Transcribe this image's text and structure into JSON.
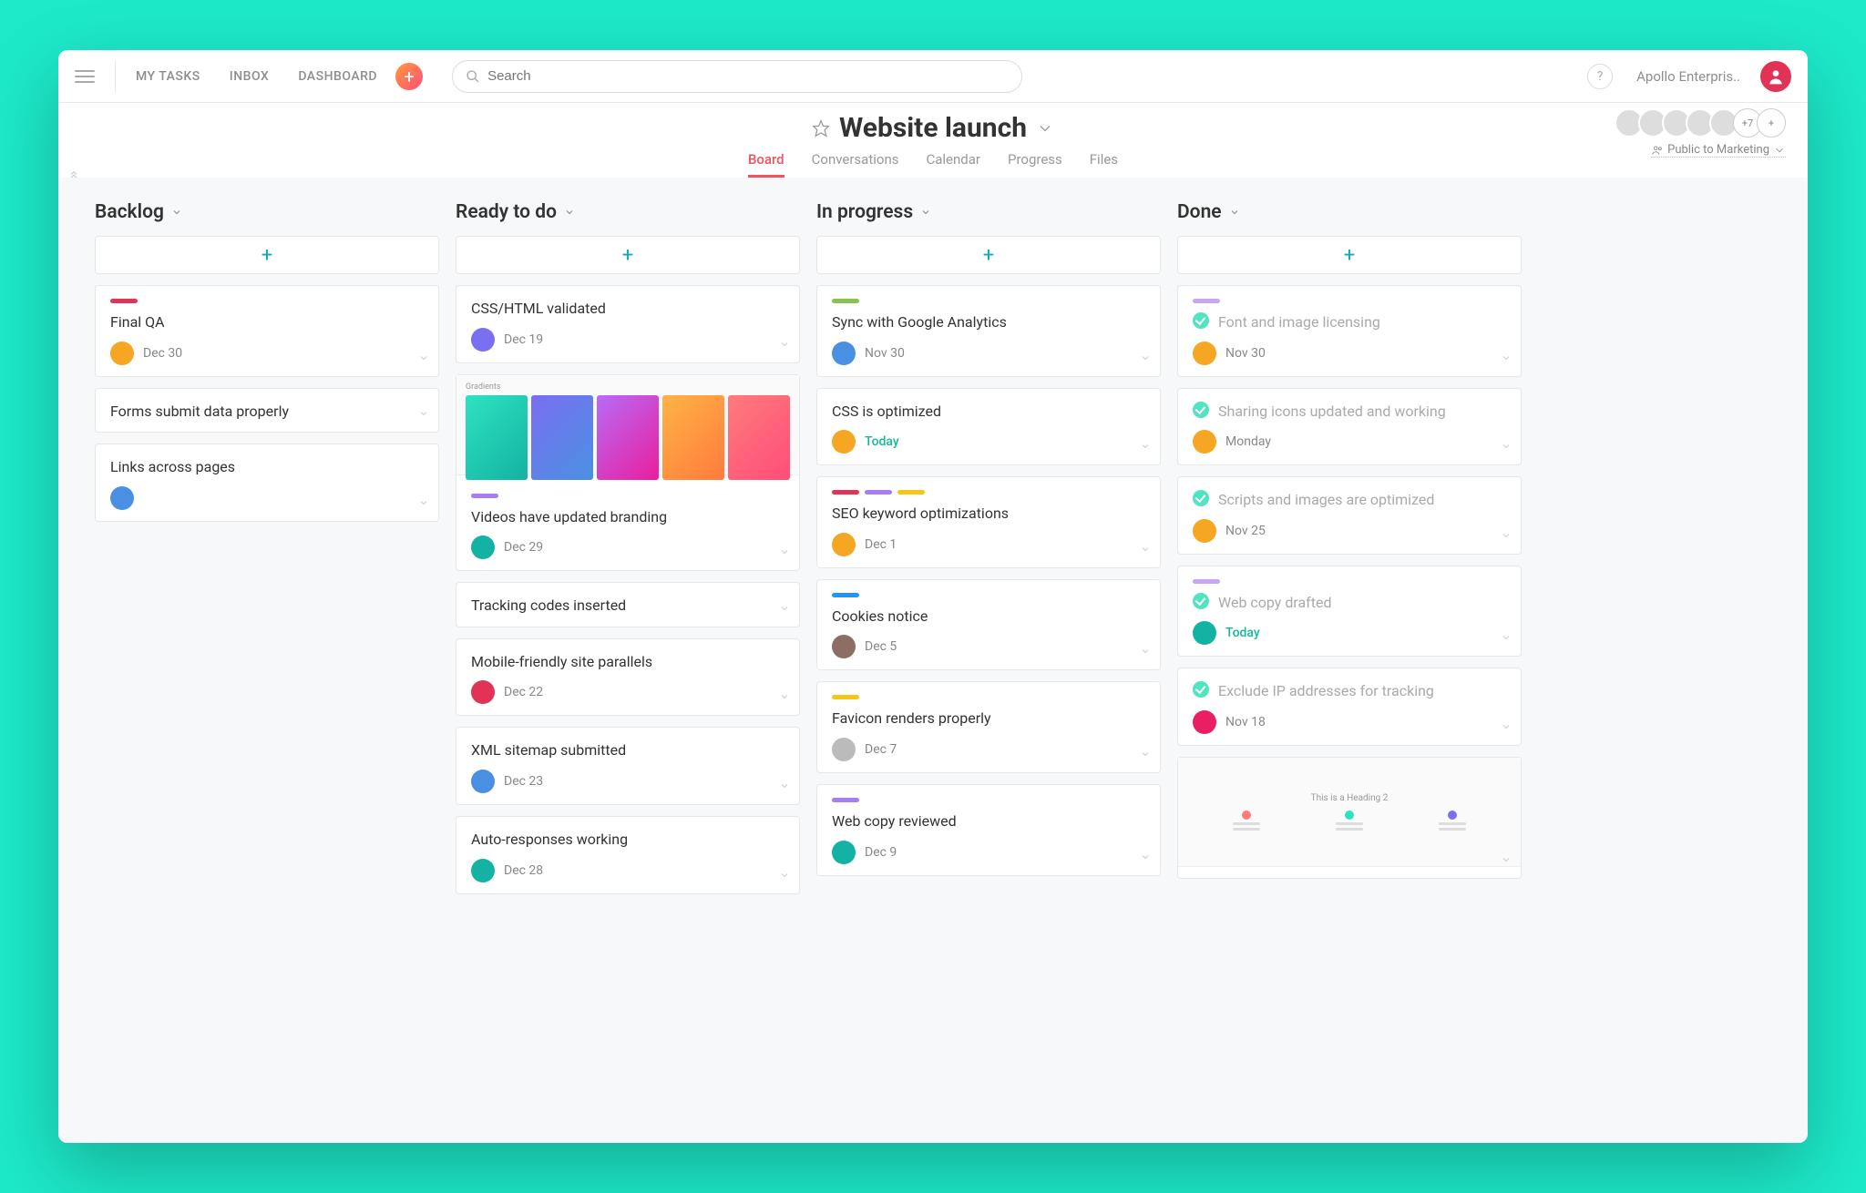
{
  "topbar": {
    "nav": [
      "MY TASKS",
      "INBOX",
      "DASHBOARD"
    ],
    "search_placeholder": "Search",
    "help": "?",
    "org_name": "Apollo Enterpris.."
  },
  "project": {
    "title": "Website launch",
    "tabs": [
      "Board",
      "Conversations",
      "Calendar",
      "Progress",
      "Files"
    ],
    "active_tab": 0,
    "overflow_count": "+7",
    "privacy": "Public to Marketing"
  },
  "columns": [
    {
      "name": "Backlog",
      "cards": [
        {
          "tags": [
            "#e03355"
          ],
          "title": "Final QA",
          "date": "Dec 30",
          "avatar": "bg-orange"
        },
        {
          "tags": [],
          "title": "Forms submit data properly",
          "date": "",
          "avatar": null
        },
        {
          "tags": [],
          "title": "Links across pages",
          "date": "",
          "avatar": "bg-blue"
        }
      ]
    },
    {
      "name": "Ready to do",
      "cards": [
        {
          "tags": [],
          "title": "CSS/HTML validated",
          "date": "Dec 19",
          "avatar": "bg-purple"
        },
        {
          "tags": [
            "#a97cf0"
          ],
          "title": "Videos have updated branding",
          "date": "Dec 29",
          "avatar": "bg-teal",
          "image": "gradients"
        },
        {
          "tags": [],
          "title": "Tracking codes inserted",
          "date": "",
          "avatar": null
        },
        {
          "tags": [],
          "title": "Mobile-friendly site parallels",
          "date": "Dec 22",
          "avatar": "bg-red"
        },
        {
          "tags": [],
          "title": "XML sitemap submitted",
          "date": "Dec 23",
          "avatar": "bg-blue"
        },
        {
          "tags": [],
          "title": "Auto-responses working",
          "date": "Dec 28",
          "avatar": "bg-teal"
        }
      ]
    },
    {
      "name": "In progress",
      "cards": [
        {
          "tags": [
            "#8bc34a"
          ],
          "title": "Sync with Google Analytics",
          "date": "Nov 30",
          "avatar": "bg-blue"
        },
        {
          "tags": [],
          "title": "CSS is optimized",
          "date": "Today",
          "avatar": "bg-orange",
          "today": true
        },
        {
          "tags": [
            "#e03355",
            "#a97cf0",
            "#f5c518"
          ],
          "title": "SEO keyword optimizations",
          "date": "Dec 1",
          "avatar": "bg-orange"
        },
        {
          "tags": [
            "#2196f3"
          ],
          "title": "Cookies notice",
          "date": "Dec 5",
          "avatar": "bg-brown"
        },
        {
          "tags": [
            "#f5c518"
          ],
          "title": "Favicon renders properly",
          "date": "Dec 7",
          "avatar": "bg-grey"
        },
        {
          "tags": [
            "#a97cf0"
          ],
          "title": "Web copy reviewed",
          "date": "Dec 9",
          "avatar": "bg-teal"
        }
      ]
    },
    {
      "name": "Done",
      "cards": [
        {
          "tags": [
            "#c7a6f5"
          ],
          "title": "Font and image licensing",
          "date": "Nov 30",
          "avatar": "bg-orange",
          "done": true
        },
        {
          "tags": [],
          "title": "Sharing icons updated and working",
          "date": "Monday",
          "avatar": "bg-orange",
          "done": true
        },
        {
          "tags": [],
          "title": "Scripts and images are optimized",
          "date": "Nov 25",
          "avatar": "bg-orange",
          "done": true
        },
        {
          "tags": [
            "#c7a6f5"
          ],
          "title": "Web copy drafted",
          "date": "Today",
          "avatar": "bg-teal",
          "done": true,
          "today": true
        },
        {
          "tags": [],
          "title": "Exclude IP addresses for tracking",
          "date": "Nov 18",
          "avatar": "bg-pink",
          "done": true
        },
        {
          "tags": [],
          "title": "",
          "date": "",
          "avatar": null,
          "done": true,
          "image": "preview"
        }
      ]
    }
  ],
  "gradient_label": "Gradients",
  "preview_heading": "This is a Heading 2"
}
